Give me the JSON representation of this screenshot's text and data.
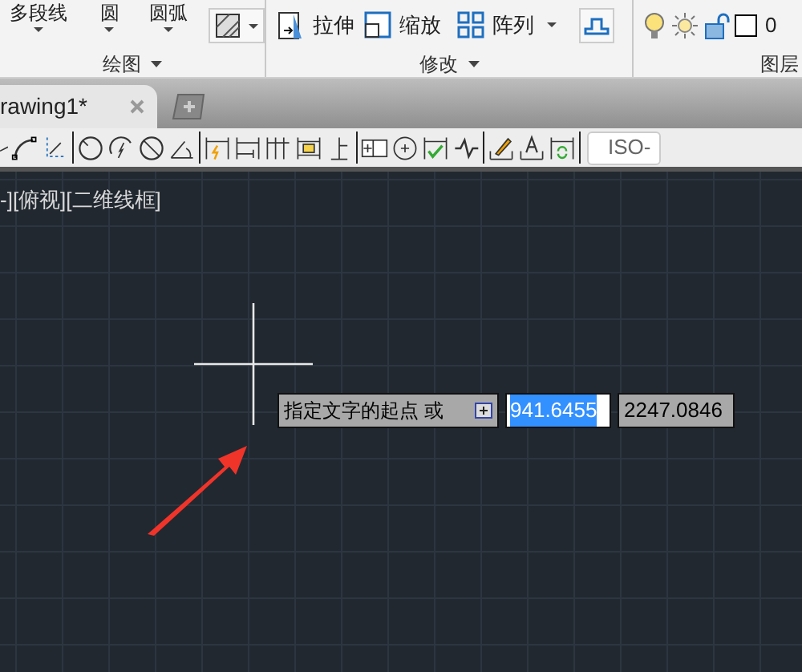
{
  "ribbon": {
    "draw_buttons": [
      {
        "label": "多段线"
      },
      {
        "label": "圆"
      },
      {
        "label": "圆弧"
      }
    ],
    "modify_buttons": [
      {
        "label": "拉伸"
      },
      {
        "label": "缩放"
      },
      {
        "label": "阵列"
      }
    ],
    "layer": {
      "name": "0"
    },
    "panels": [
      {
        "title": "绘图"
      },
      {
        "title": "修改"
      },
      {
        "title": "图层"
      }
    ]
  },
  "document_tabs": [
    {
      "label": "rawing1*",
      "selected": true
    }
  ],
  "toolbar": {
    "style": "ISO-"
  },
  "viewport": {
    "label": "-][俯视][二维线框]"
  },
  "prompt": {
    "text": "指定文字的起点 或",
    "x_value": "941.6455",
    "y_value": "2247.0846"
  }
}
